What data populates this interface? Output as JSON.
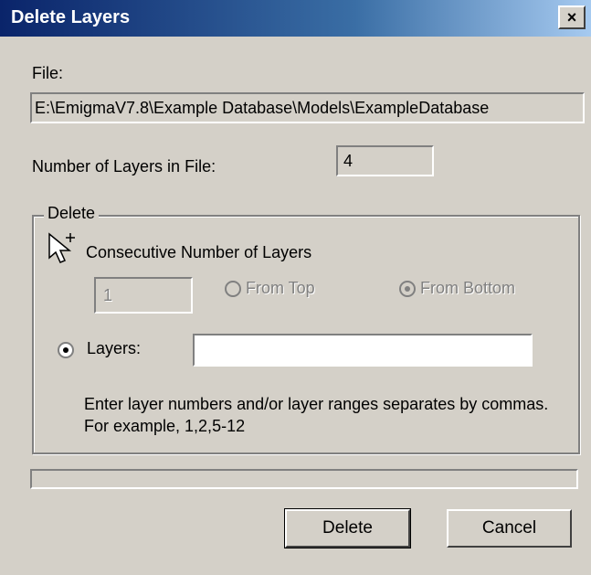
{
  "window": {
    "title": "Delete Layers",
    "close_glyph": "×"
  },
  "file": {
    "label": "File:",
    "path": "E:\\EmigmaV7.8\\Example Database\\Models\\ExampleDatabase"
  },
  "layers_count": {
    "label": "Number of Layers in File:",
    "value": "4"
  },
  "delete_group": {
    "legend": "Delete",
    "consecutive": {
      "label": "Consecutive Number of Layers",
      "value": "1"
    },
    "from_top": {
      "label": "From Top",
      "selected": false,
      "enabled": false
    },
    "from_bottom": {
      "label": "From Bottom",
      "selected": true,
      "enabled": false
    },
    "layers_option": {
      "label": "Layers:",
      "selected": true,
      "value": ""
    },
    "hint": "Enter layer numbers and/or layer ranges separates by commas. For example, 1,2,5-12"
  },
  "buttons": {
    "delete": "Delete",
    "cancel": "Cancel"
  },
  "icons": {
    "cursor": "arrow-cursor-icon",
    "close": "close-icon"
  }
}
